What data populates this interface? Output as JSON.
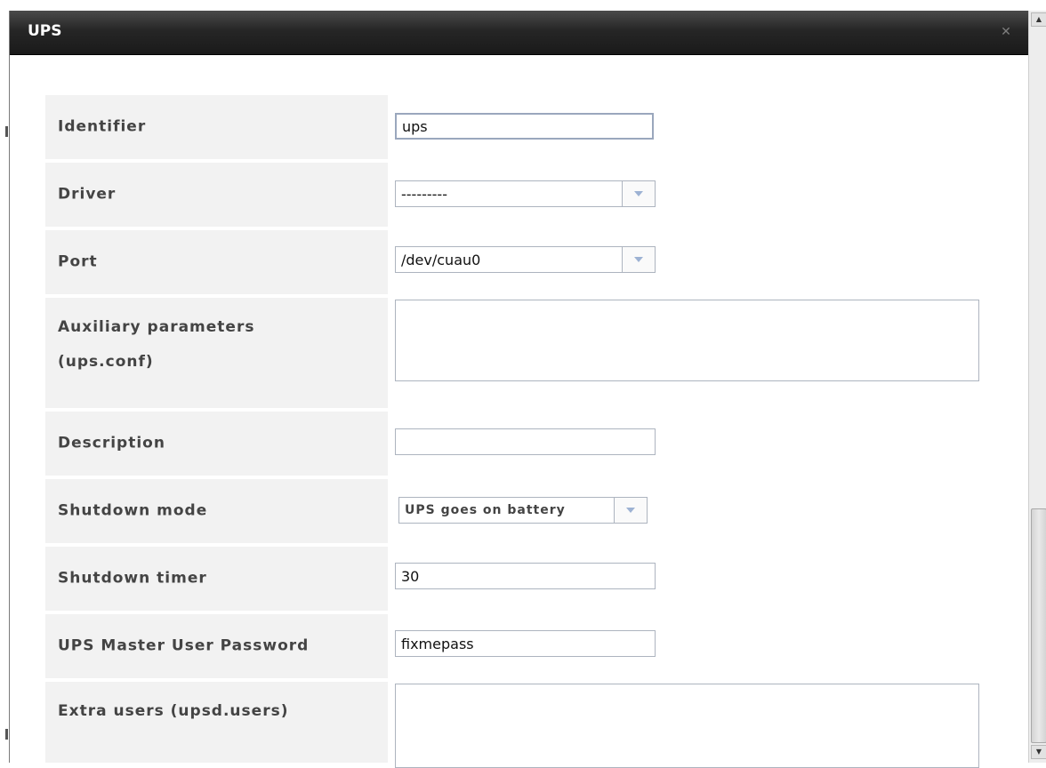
{
  "dialog": {
    "title": "UPS",
    "close_icon": "close-icon"
  },
  "fields": {
    "identifier": {
      "label": "Identifier",
      "value": "ups"
    },
    "driver": {
      "label": "Driver",
      "value": "---------"
    },
    "port": {
      "label": "Port",
      "value": "/dev/cuau0"
    },
    "aux_params": {
      "label_line1": "Auxiliary parameters",
      "label_line2": "(ups.conf)",
      "value": ""
    },
    "description": {
      "label": "Description",
      "value": ""
    },
    "shutdown_mode": {
      "label": "Shutdown mode",
      "value": "UPS goes on battery"
    },
    "shutdown_timer": {
      "label": "Shutdown timer",
      "value": "30"
    },
    "master_password": {
      "label": "UPS Master User Password",
      "value": "fixmepass"
    },
    "extra_users": {
      "label": "Extra users (upsd.users)",
      "value": ""
    }
  },
  "colors": {
    "titlebar": "#262626",
    "label_bg": "#f2f2f2",
    "label_text": "#444444",
    "dropdown_arrow": "#9db2d3"
  }
}
